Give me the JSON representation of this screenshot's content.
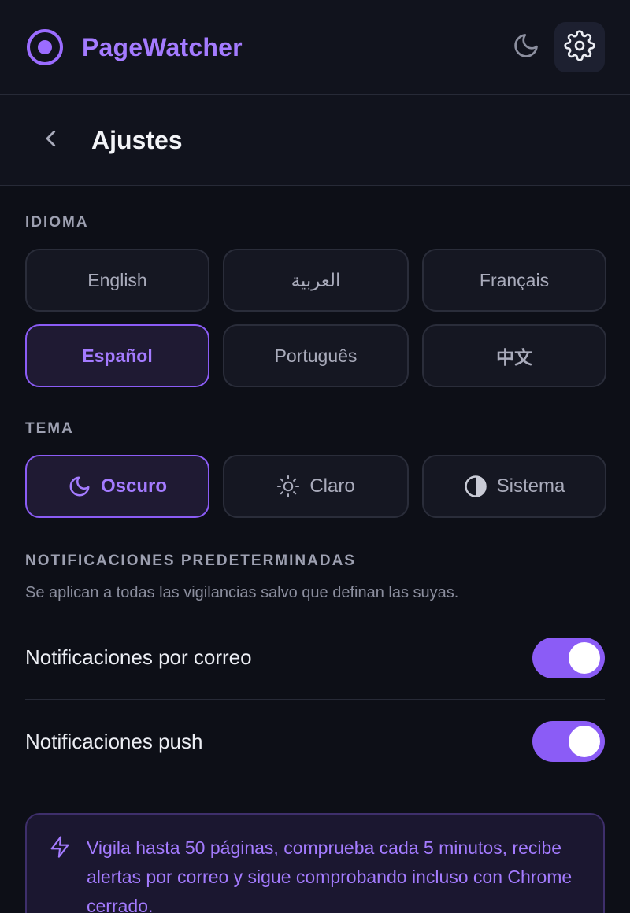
{
  "header": {
    "app_name": "PageWatcher",
    "icons": {
      "logo": "record-icon",
      "theme": "moon-icon",
      "settings": "gear-icon"
    }
  },
  "subheader": {
    "back_icon": "chevron-left-icon",
    "title": "Ajustes"
  },
  "language": {
    "label": "IDIOMA",
    "options": [
      {
        "label": "English",
        "selected": false
      },
      {
        "label": "العربية",
        "selected": false
      },
      {
        "label": "Français",
        "selected": false
      },
      {
        "label": "Español",
        "selected": true
      },
      {
        "label": "Português",
        "selected": false
      },
      {
        "label": "中文",
        "selected": false
      }
    ]
  },
  "theme": {
    "label": "TEMA",
    "options": [
      {
        "label": "Oscuro",
        "icon": "moon-icon",
        "selected": true
      },
      {
        "label": "Claro",
        "icon": "sun-icon",
        "selected": false
      },
      {
        "label": "Sistema",
        "icon": "contrast-icon",
        "selected": false
      }
    ]
  },
  "notifications": {
    "label": "NOTIFICACIONES PREDETERMINADAS",
    "description": "Se aplican a todas las vigilancias salvo que definan las suyas.",
    "email": {
      "label": "Notificaciones por correo",
      "enabled": true
    },
    "push": {
      "label": "Notificaciones push",
      "enabled": true
    }
  },
  "info": {
    "icon": "lightning-icon",
    "text": "Vigila hasta 50 páginas, comprueba cada 5 minutos, recibe alertas por correo y sigue comprobando incluso con Chrome cerrado."
  },
  "colors": {
    "accent": "#8b5cf6",
    "accent_text": "#a47bff",
    "background": "#0d0f17",
    "header_bg": "#11131d"
  }
}
